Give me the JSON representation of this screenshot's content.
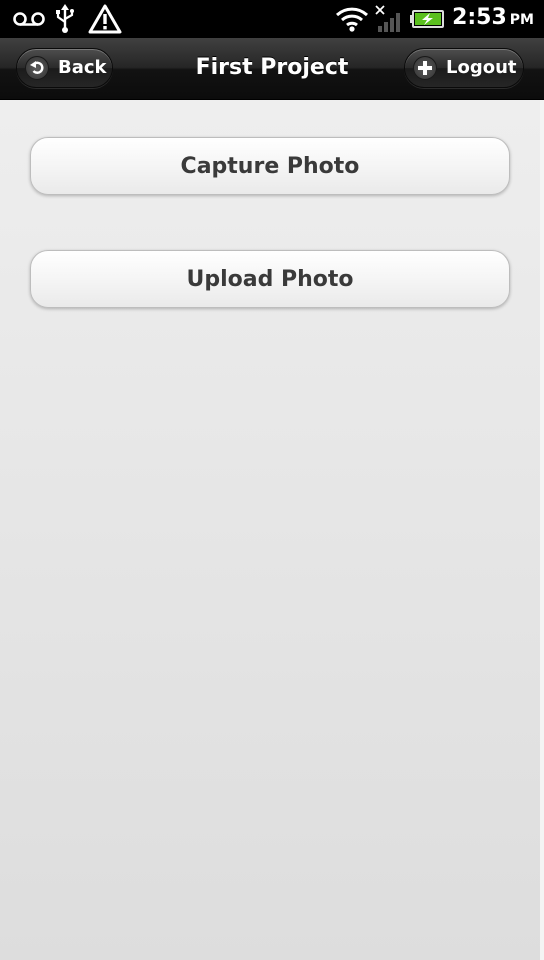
{
  "status_bar": {
    "icons_left": [
      "voicemail-icon",
      "usb-icon",
      "warning-icon"
    ],
    "icons_right": [
      "wifi-icon",
      "no-signal-icon",
      "battery-charging-icon"
    ],
    "time": "2:53",
    "ampm": "PM",
    "battery_color": "#5bbf1e"
  },
  "header": {
    "title": "First Project",
    "back_label": "Back",
    "logout_label": "Logout"
  },
  "main": {
    "capture_label": "Capture Photo",
    "upload_label": "Upload Photo"
  },
  "colors": {
    "header_bg": "#1c1c1c",
    "content_bg": "#e4e4e4",
    "button_text": "#3a3a3a"
  }
}
